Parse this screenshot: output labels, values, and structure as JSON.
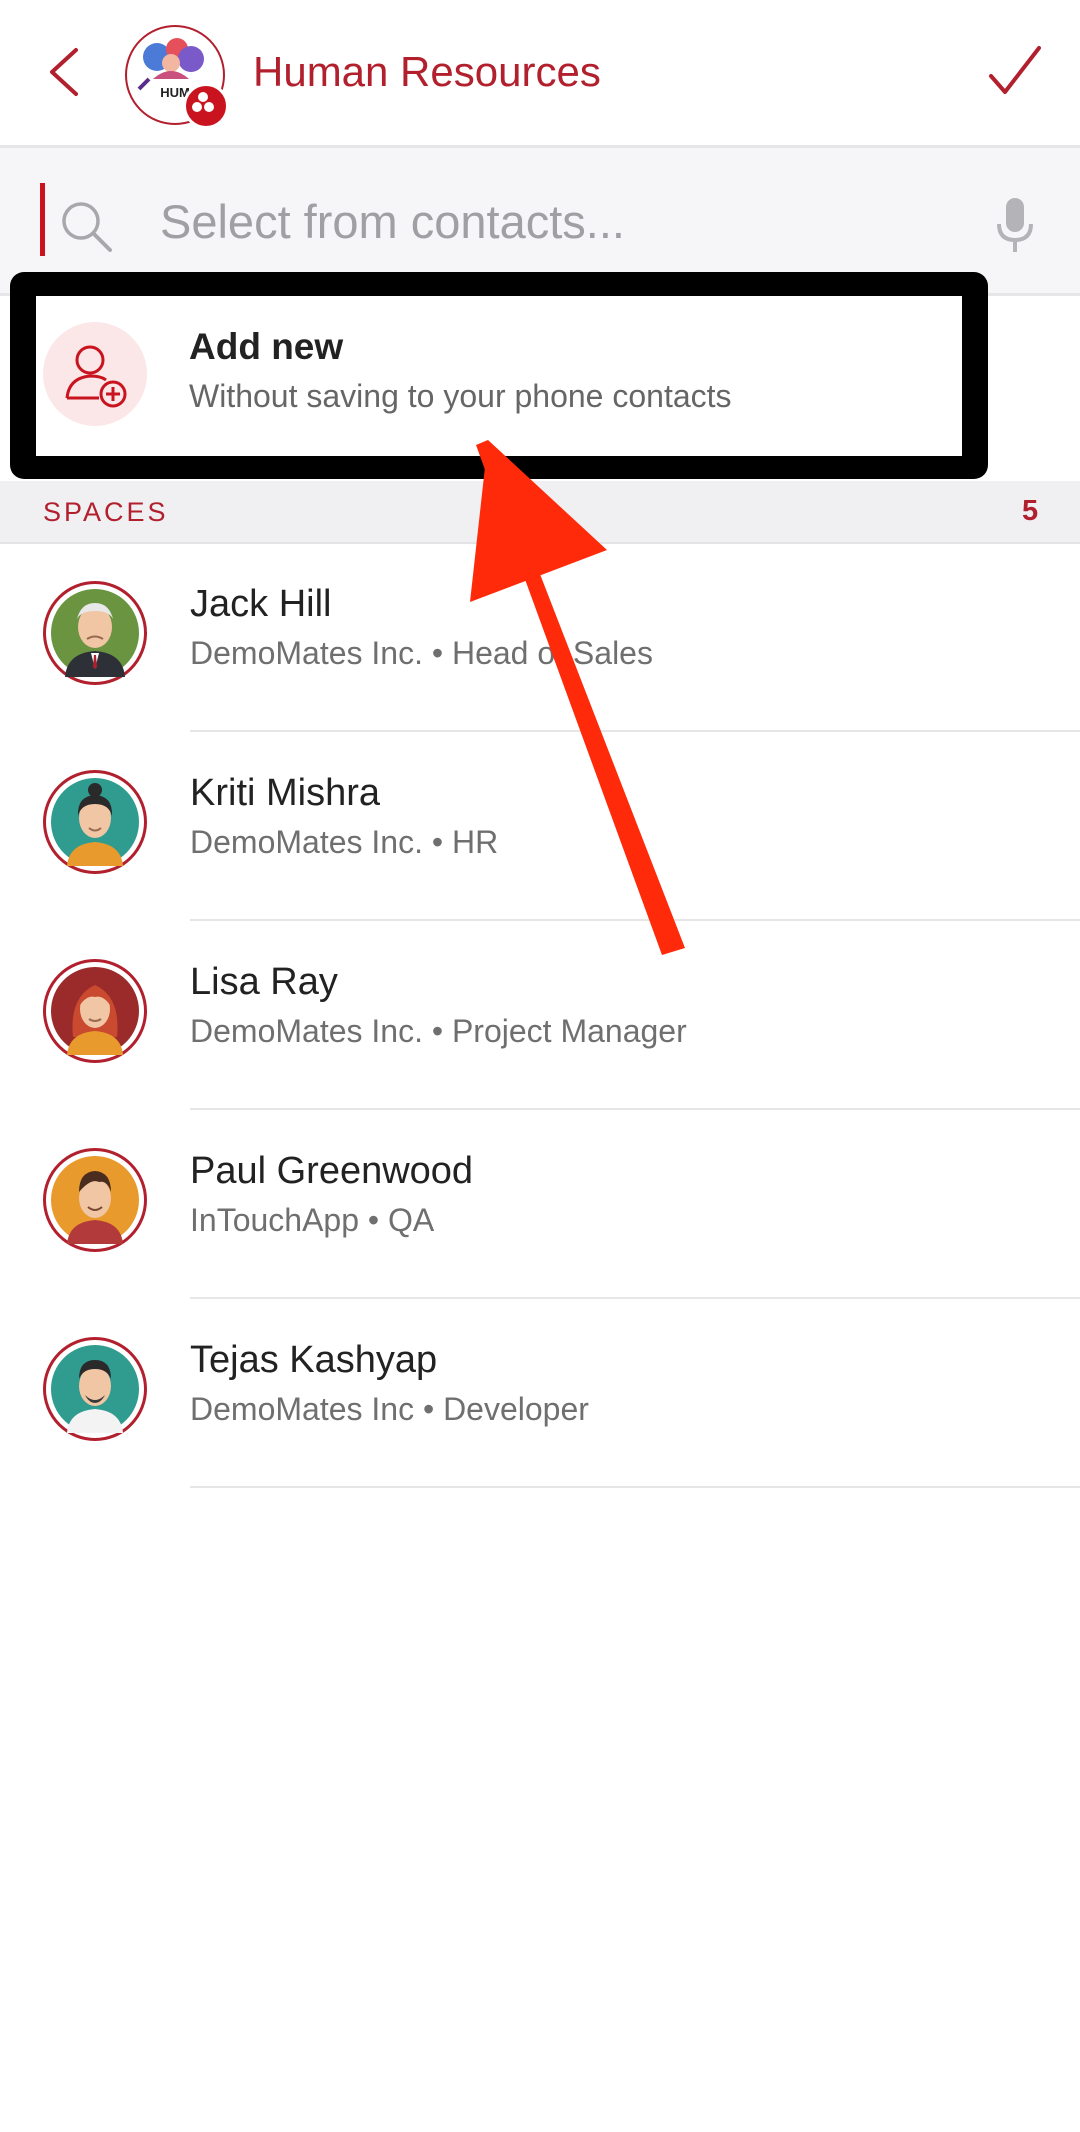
{
  "header": {
    "title": "Human Resources",
    "group_avatar_text": "HUM",
    "back_icon": "chevron-left-icon",
    "confirm_icon": "checkmark-icon",
    "accent_color": "#b21f2d"
  },
  "search": {
    "placeholder": "Select from contacts...",
    "value": "",
    "search_icon": "search-icon",
    "mic_icon": "microphone-icon"
  },
  "add_new": {
    "title": "Add new",
    "subtitle": "Without saving to your phone contacts",
    "icon": "add-person-icon"
  },
  "section": {
    "title": "SPACES",
    "count": "5"
  },
  "contacts": [
    {
      "name": "Jack Hill",
      "subtitle": "DemoMates Inc. • Head of Sales",
      "avatar_color": "#6a9440"
    },
    {
      "name": "Kriti Mishra",
      "subtitle": "DemoMates Inc. • HR",
      "avatar_color": "#2f9c8f"
    },
    {
      "name": "Lisa Ray",
      "subtitle": "DemoMates Inc. • Project Manager",
      "avatar_color": "#9b2b2b"
    },
    {
      "name": "Paul Greenwood",
      "subtitle": "InTouchApp • QA",
      "avatar_color": "#e89a2c"
    },
    {
      "name": "Tejas Kashyap",
      "subtitle": "DemoMates Inc • Developer",
      "avatar_color": "#2f9c8f"
    }
  ],
  "annotation": {
    "arrow_color": "#ff2a0a",
    "highlight_frame_color": "#000000"
  }
}
